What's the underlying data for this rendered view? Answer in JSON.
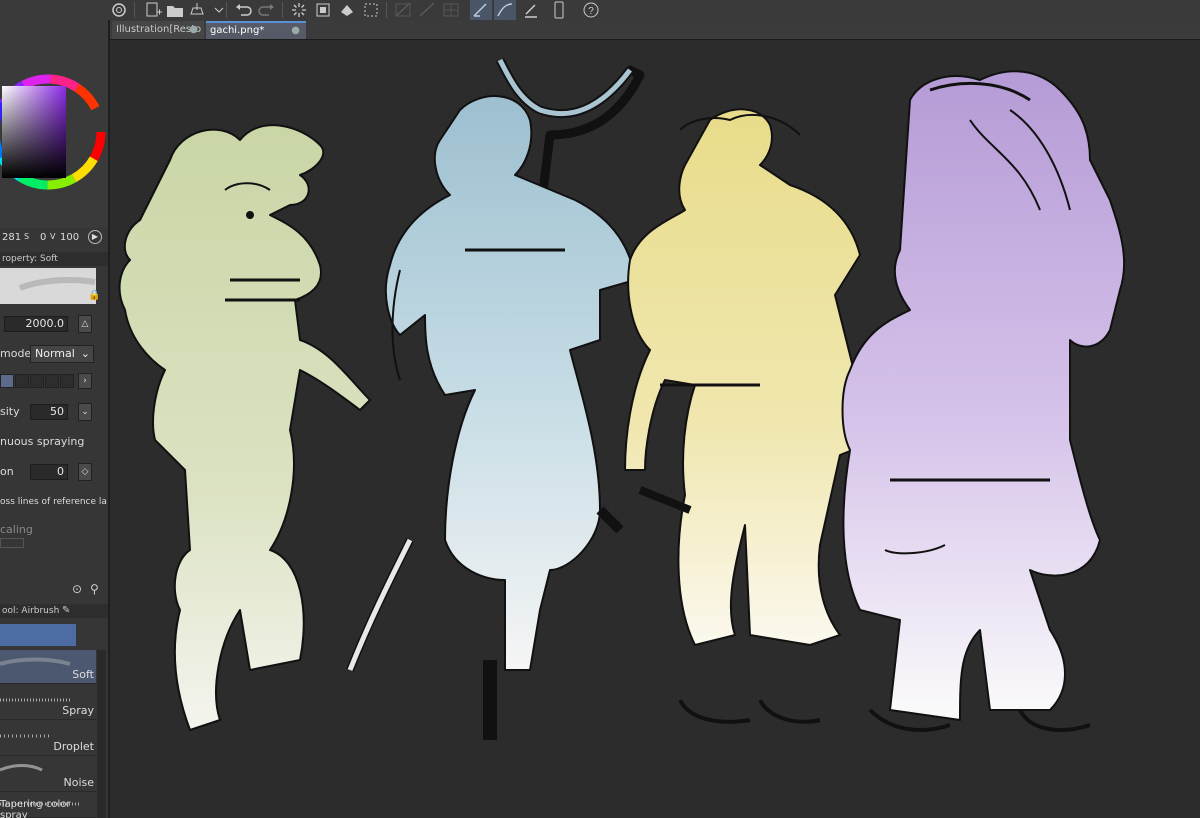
{
  "toolbar": {
    "icons": [
      "clip-studio-icon",
      "new-canvas-icon",
      "open-folder-icon",
      "save-icon",
      "menu-chevron-icon",
      "undo-icon",
      "redo-icon",
      "loading-icon",
      "fill-icon",
      "transform-icon",
      "selection-icon",
      "snap-icon",
      "ruler-icon",
      "pen-icon",
      "line-icon",
      "edit-icon",
      "phone-icon",
      "help-icon"
    ]
  },
  "tabs": [
    {
      "label": "Illustration[Resto",
      "active": false
    },
    {
      "label": "gachi.png*",
      "active": true
    }
  ],
  "color": {
    "values": {
      "a": "281",
      "b": "0",
      "c": "100"
    },
    "current": "#7b2fd0"
  },
  "tool_property": {
    "header": "roperty: Soft",
    "brush_size": "2000.0",
    "blending_mode_label": "mode",
    "blending_mode_value": "Normal",
    "density_label": "sity",
    "density_value": "50",
    "continuous_spraying": "nuous spraying",
    "option_label": "on",
    "option_value": "0",
    "reference_lines": "oss lines of reference la",
    "scaling_label": "caling"
  },
  "sub_tool": {
    "header": "ool: Airbrush",
    "brushes": [
      {
        "label": "Soft",
        "selected": true
      },
      {
        "label": "Spray",
        "selected": false
      },
      {
        "label": "Droplet",
        "selected": false
      },
      {
        "label": "Noise",
        "selected": false
      }
    ],
    "cutoff": "Tapering color spray"
  },
  "canvas": {
    "background": "#2c2c2c",
    "figures": [
      {
        "name": "girl-with-cap",
        "tint": "#c9d6a6"
      },
      {
        "name": "man-with-staff",
        "tint": "#a9c5d2"
      },
      {
        "name": "worker-with-hammer",
        "tint": "#e8dc8a"
      },
      {
        "name": "dreadlocks-figure",
        "tint": "#b9a0d8"
      }
    ]
  }
}
